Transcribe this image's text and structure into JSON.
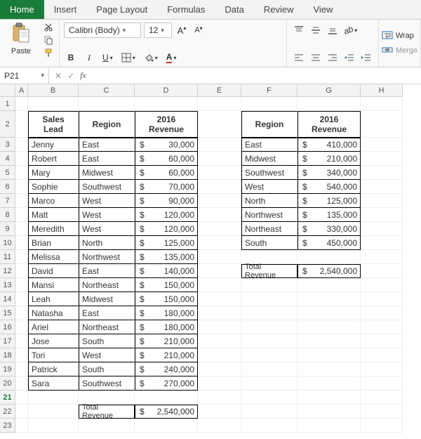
{
  "tabs": [
    "Home",
    "Insert",
    "Page Layout",
    "Formulas",
    "Data",
    "Review",
    "View"
  ],
  "activeTab": "Home",
  "ribbon": {
    "pasteLabel": "Paste",
    "fontName": "Calibri (Body)",
    "fontSize": "12",
    "wrapLabel": "Wrap",
    "mergeLabel": "Merge"
  },
  "nameBox": "P21",
  "columns": [
    "A",
    "B",
    "C",
    "D",
    "E",
    "F",
    "G",
    "H"
  ],
  "sheet": {
    "table1": {
      "headers": [
        "Sales Lead",
        "Region",
        "2016 Revenue"
      ],
      "rows": [
        [
          "Jenny",
          "East",
          "30,000"
        ],
        [
          "Robert",
          "East",
          "60,000"
        ],
        [
          "Mary",
          "Midwest",
          "60,000"
        ],
        [
          "Sophie",
          "Southwest",
          "70,000"
        ],
        [
          "Marco",
          "West",
          "90,000"
        ],
        [
          "Matt",
          "West",
          "120,000"
        ],
        [
          "Meredith",
          "West",
          "120,000"
        ],
        [
          "Brian",
          "North",
          "125,000"
        ],
        [
          "Melissa",
          "Northwest",
          "135,000"
        ],
        [
          "David",
          "East",
          "140,000"
        ],
        [
          "Mansi",
          "Northeast",
          "150,000"
        ],
        [
          "Leah",
          "Midwest",
          "150,000"
        ],
        [
          "Natasha",
          "East",
          "180,000"
        ],
        [
          "Ariel",
          "Northeast",
          "180,000"
        ],
        [
          "Jose",
          "South",
          "210,000"
        ],
        [
          "Tori",
          "West",
          "210,000"
        ],
        [
          "Patrick",
          "South",
          "240,000"
        ],
        [
          "Sara",
          "Southwest",
          "270,000"
        ]
      ],
      "totalLabel": "Total Revenue",
      "totalValue": "2,540,000"
    },
    "table2": {
      "headers": [
        "Region",
        "2016 Revenue"
      ],
      "rows": [
        [
          "East",
          "410,000"
        ],
        [
          "Midwest",
          "210,000"
        ],
        [
          "Southwest",
          "340,000"
        ],
        [
          "West",
          "540,000"
        ],
        [
          "North",
          "125,000"
        ],
        [
          "Northwest",
          "135,000"
        ],
        [
          "Northeast",
          "330,000"
        ],
        [
          "South",
          "450,000"
        ]
      ],
      "totalLabel": "Total Revenue",
      "totalValue": "2,540,000"
    }
  },
  "currency": "$"
}
